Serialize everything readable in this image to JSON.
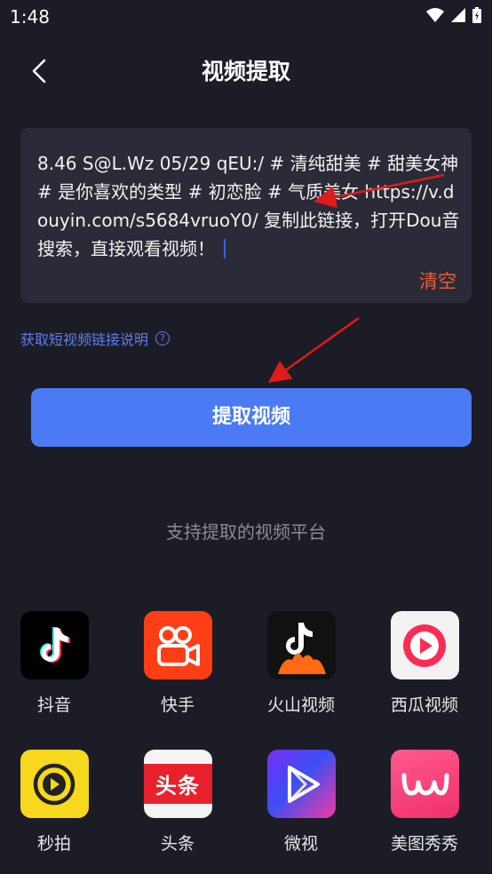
{
  "status": {
    "time": "1:48"
  },
  "header": {
    "title": "视频提取"
  },
  "input": {
    "text": "8.46 S@L.Wz 05/29 qEU:/ # 清纯甜美 # 甜美女神 # 是你喜欢的类型 # 初恋脸 # 气质美女 https://v.douyin.com/s5684vruoY0/ 复制此链接，打开Dou音搜索，直接观看视频！",
    "clear_label": "清空"
  },
  "help_link": {
    "label": "获取短视频链接说明",
    "icon": "question-circle-icon"
  },
  "extract_button": {
    "label": "提取视频"
  },
  "platforms": {
    "title": "支持提取的视频平台",
    "items": [
      {
        "label": "抖音",
        "icon": "douyin-icon"
      },
      {
        "label": "快手",
        "icon": "kuaishou-icon"
      },
      {
        "label": "火山视频",
        "icon": "huoshan-icon"
      },
      {
        "label": "西瓜视频",
        "icon": "xigua-icon"
      },
      {
        "label": "秒拍",
        "icon": "miaopai-icon"
      },
      {
        "label": "头条",
        "icon": "toutiao-icon",
        "badge_text": "头条"
      },
      {
        "label": "微视",
        "icon": "weishi-icon"
      },
      {
        "label": "美图秀秀",
        "icon": "meitu-icon"
      }
    ]
  },
  "colors": {
    "background": "#1c1c26",
    "card": "#2b2b37",
    "accent_blue": "#4a7bf4",
    "clear_red": "#f05a3c",
    "link_blue": "#5d7ff0"
  }
}
